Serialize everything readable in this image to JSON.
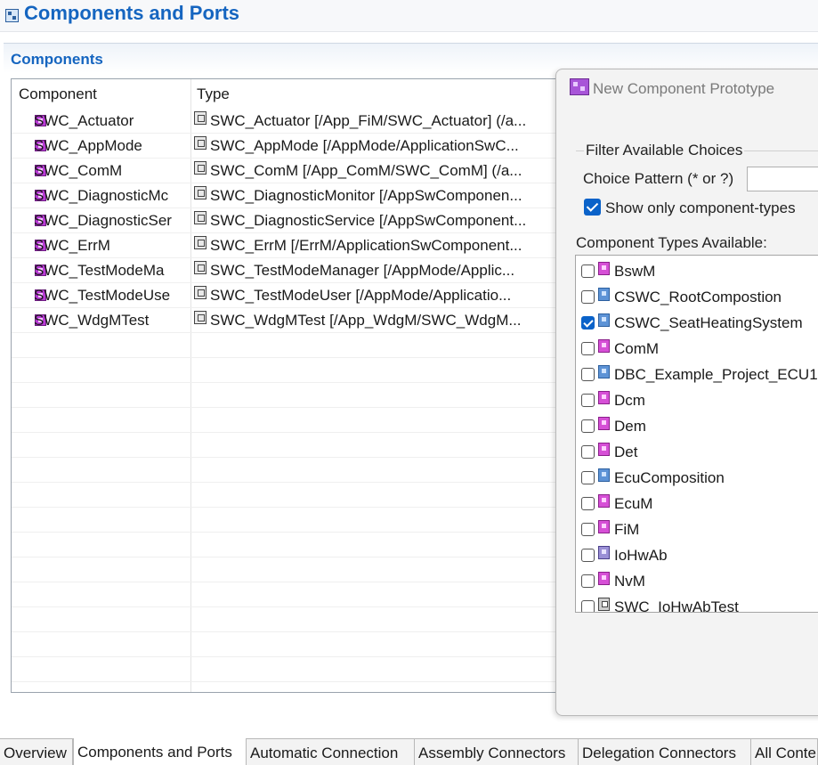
{
  "header": {
    "title": "Components and Ports"
  },
  "section": {
    "title": "Components"
  },
  "table": {
    "columns": [
      "Component",
      "Type"
    ],
    "rows": [
      {
        "component": "SWC_Actuator",
        "type": "SWC_Actuator [/App_FiM/SWC_Actuator] (/a..."
      },
      {
        "component": "SWC_AppMode",
        "type": "SWC_AppMode [/AppMode/ApplicationSwC..."
      },
      {
        "component": "SWC_ComM",
        "type": "SWC_ComM [/App_ComM/SWC_ComM] (/a..."
      },
      {
        "component": "SWC_DiagnosticMc",
        "type": "SWC_DiagnosticMonitor [/AppSwComponen..."
      },
      {
        "component": "SWC_DiagnosticSer",
        "type": "SWC_DiagnosticService [/AppSwComponent..."
      },
      {
        "component": "SWC_ErrM",
        "type": "SWC_ErrM [/ErrM/ApplicationSwComponent..."
      },
      {
        "component": "SWC_TestModeMa",
        "type": "SWC_TestModeManager [/AppMode/Applic..."
      },
      {
        "component": "SWC_TestModeUse",
        "type": "SWC_TestModeUser [/AppMode/Applicatio..."
      },
      {
        "component": "SWC_WdgMTest",
        "type": "SWC_WdgMTest [/App_WdgM/SWC_WdgM..."
      }
    ]
  },
  "dialog": {
    "title": "New Component Prototype",
    "filter_legend": "Filter Available Choices",
    "choice_pattern_label": "Choice Pattern (* or ?)",
    "choice_pattern_value": "",
    "show_only_label": "Show only component-types",
    "show_only_checked": true,
    "available_label": "Component Types Available:",
    "items": [
      {
        "label": "BswM",
        "checked": false,
        "icon": "bsw-module-icon"
      },
      {
        "label": "CSWC_RootCompostion",
        "checked": false,
        "icon": "composition-icon"
      },
      {
        "label": "CSWC_SeatHeatingSystem",
        "checked": true,
        "icon": "composition-icon"
      },
      {
        "label": "ComM",
        "checked": false,
        "icon": "bsw-module-icon"
      },
      {
        "label": "DBC_Example_Project_ECU1",
        "checked": false,
        "icon": "composition-icon"
      },
      {
        "label": "Dcm",
        "checked": false,
        "icon": "bsw-module-icon"
      },
      {
        "label": "Dem",
        "checked": false,
        "icon": "bsw-module-icon"
      },
      {
        "label": "Det",
        "checked": false,
        "icon": "bsw-module-icon"
      },
      {
        "label": "EcuComposition",
        "checked": false,
        "icon": "composition-icon"
      },
      {
        "label": "EcuM",
        "checked": false,
        "icon": "bsw-module-icon"
      },
      {
        "label": "FiM",
        "checked": false,
        "icon": "bsw-module-icon"
      },
      {
        "label": "IoHwAb",
        "checked": false,
        "icon": "iohwab-icon"
      },
      {
        "label": "NvM",
        "checked": false,
        "icon": "bsw-module-icon"
      },
      {
        "label": "SWC_IoHwAbTest",
        "checked": false,
        "icon": "application-swc-icon"
      }
    ]
  },
  "tabs": [
    {
      "label": "Overview",
      "active": false
    },
    {
      "label": "Components and Ports",
      "active": true
    },
    {
      "label": "Automatic Connection",
      "active": false
    },
    {
      "label": "Assembly Connectors",
      "active": false
    },
    {
      "label": "Delegation Connectors",
      "active": false
    },
    {
      "label": "All Conte",
      "active": false
    }
  ]
}
